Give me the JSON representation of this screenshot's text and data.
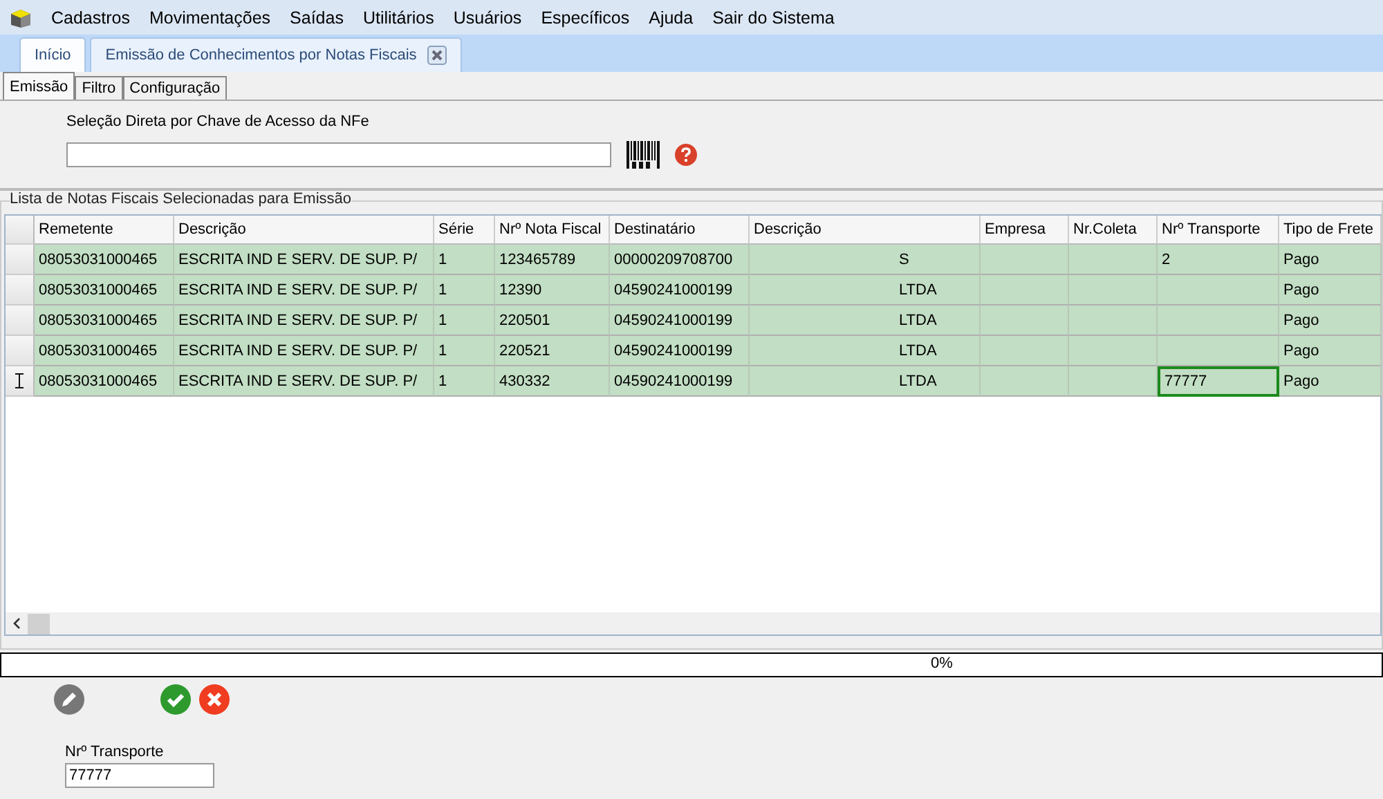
{
  "menu": [
    "Cadastros",
    "Movimentações",
    "Saídas",
    "Utilitários",
    "Usuários",
    "Específicos",
    "Ajuda",
    "Sair do Sistema"
  ],
  "doc_tabs": [
    {
      "label": "Início",
      "selected": false,
      "closable": false
    },
    {
      "label": "Emissão de Conhecimentos por Notas Fiscais",
      "selected": true,
      "closable": true
    }
  ],
  "sub_tabs": [
    {
      "label": "Emissão",
      "selected": true
    },
    {
      "label": "Filtro",
      "selected": false
    },
    {
      "label": "Configuração",
      "selected": false
    }
  ],
  "key_field": {
    "label": "Seleção Direta por Chave de Acesso da NFe"
  },
  "table": {
    "title": "Lista de Notas Fiscais Selecionadas para Emissão",
    "columns": [
      "Remetente",
      "Descrição",
      "Série",
      "Nrº Nota Fiscal",
      "Destinatário",
      "Descrição",
      "Empresa",
      "Nr.Coleta",
      "Nrº Transporte",
      "Tipo de Frete"
    ],
    "rows": [
      {
        "selected": false,
        "cells": [
          "08053031000465",
          "ESCRITA IND E SERV. DE SUP. P/",
          "1",
          "123465789",
          "00000209708700",
          "S",
          "",
          "",
          "2",
          "Pago"
        ]
      },
      {
        "selected": false,
        "cells": [
          "08053031000465",
          "ESCRITA IND E SERV. DE SUP. P/",
          "1",
          "12390",
          "04590241000199",
          "LTDA",
          "",
          "",
          "",
          "Pago"
        ]
      },
      {
        "selected": false,
        "cells": [
          "08053031000465",
          "ESCRITA IND E SERV. DE SUP. P/",
          "1",
          "220501",
          "04590241000199",
          "LTDA",
          "",
          "",
          "",
          "Pago"
        ]
      },
      {
        "selected": false,
        "cells": [
          "08053031000465",
          "ESCRITA IND E SERV. DE SUP. P/",
          "1",
          "220521",
          "04590241000199",
          "LTDA",
          "",
          "",
          "",
          "Pago"
        ]
      },
      {
        "selected": true,
        "cells": [
          "08053031000465",
          "ESCRITA IND E SERV. DE SUP. P/",
          "1",
          "430332",
          "04590241000199",
          "LTDA",
          "",
          "",
          "77777",
          "Pago"
        ]
      }
    ]
  },
  "progress": {
    "level": 0,
    "reading": "0%"
  },
  "transport_field": {
    "label": "Nrº Transporte",
    "value": "77777"
  }
}
